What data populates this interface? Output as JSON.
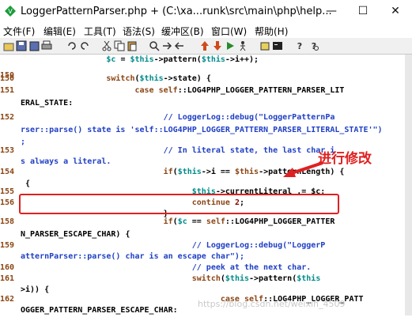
{
  "window": {
    "title": "LoggerPatternParser.php + (C:\\xa...runk\\src\\main\\php\\help..."
  },
  "menu": [
    "文件(F)",
    "编辑(E)",
    "工具(T)",
    "语法(S)",
    "缓冲区(B)",
    "窗口(W)",
    "帮助(H)"
  ],
  "editor": {
    "lines": [
      {
        "num": "",
        "tokens": [
          [
            "v",
            "                  $c"
          ],
          [
            "",
            " = "
          ],
          [
            "v",
            "$this"
          ],
          [
            "",
            "->pattern("
          ],
          [
            "v",
            "$this"
          ],
          [
            "",
            "->i++);"
          ]
        ]
      },
      {
        "num": "150",
        "tokens": []
      },
      {
        "num": "150",
        "tokens": [
          [
            "k",
            "                  switch"
          ],
          [
            "",
            "("
          ],
          [
            "v",
            "$this"
          ],
          [
            "",
            "->state) {"
          ]
        ]
      },
      {
        "num": "151",
        "tokens": [
          [
            "k",
            "                        case"
          ],
          [
            "",
            " "
          ],
          [
            "k",
            "self"
          ],
          [
            "",
            "::LOG4PHP_LOGGER_PATTERN_PARSER_LIT"
          ]
        ]
      },
      {
        "num": "",
        "tokens": [
          [
            "",
            "ERAL_STATE:"
          ]
        ]
      },
      {
        "num": "152",
        "tokens": [
          [
            "c",
            "                              // LoggerLog::debug(\"LoggerPatternPa"
          ]
        ]
      },
      {
        "num": "",
        "tokens": [
          [
            "c",
            "rser::parse() state is 'self::LOG4PHP_LOGGER_PATTERN_PARSER_LITERAL_STATE'\")"
          ]
        ]
      },
      {
        "num": "",
        "tokens": [
          [
            "c",
            ";"
          ]
        ]
      },
      {
        "num": "153",
        "tokens": [
          [
            "c",
            "                              // In literal state, the last char i"
          ]
        ]
      },
      {
        "num": "",
        "tokens": [
          [
            "c",
            "s always a literal."
          ]
        ]
      },
      {
        "num": "154",
        "tokens": [
          [
            "k",
            "                              if"
          ],
          [
            "",
            "("
          ],
          [
            "v",
            "$this"
          ],
          [
            "",
            "->i == "
          ],
          [
            "k",
            "$this"
          ],
          [
            "",
            "->patternLength) {"
          ]
        ]
      },
      {
        "num": "",
        "tokens": [
          [
            "",
            " {"
          ]
        ]
      },
      {
        "num": "155",
        "tokens": [
          [
            "v",
            "                                    $this"
          ],
          [
            "",
            "->currentLiteral .= $c;"
          ]
        ]
      },
      {
        "num": "156",
        "tokens": [
          [
            "k",
            "                                    continue"
          ],
          [
            "",
            " "
          ],
          [
            "s",
            "2"
          ],
          [
            "",
            ";"
          ]
        ]
      },
      {
        "num": "",
        "tokens": [
          [
            "",
            "                              }"
          ]
        ]
      },
      {
        "num": "158",
        "tokens": [
          [
            "k",
            "                              if"
          ],
          [
            "",
            "("
          ],
          [
            "v",
            "$c"
          ],
          [
            "",
            " == "
          ],
          [
            "k",
            "self"
          ],
          [
            "",
            "::LOG4PHP_LOGGER_PATTER"
          ]
        ]
      },
      {
        "num": "",
        "tokens": [
          [
            "",
            "N_PARSER_ESCAPE_CHAR) {"
          ]
        ]
      },
      {
        "num": "159",
        "tokens": [
          [
            "c",
            "                                    // LoggerLog::debug(\"LoggerP"
          ]
        ]
      },
      {
        "num": "",
        "tokens": [
          [
            "c",
            "atternParser::parse() char is an escape char\");"
          ]
        ]
      },
      {
        "num": "160",
        "tokens": [
          [
            "c",
            "                                    // peek at the next char."
          ]
        ]
      },
      {
        "num": "161",
        "tokens": [
          [
            "k",
            "                                    switch"
          ],
          [
            "",
            "("
          ],
          [
            "v",
            "$this"
          ],
          [
            "",
            "->pattern("
          ],
          [
            "v",
            "$this"
          ]
        ]
      },
      {
        "num": "",
        "tokens": [
          [
            "",
            ">i)) {"
          ]
        ]
      },
      {
        "num": "162",
        "tokens": [
          [
            "k",
            "                                          case"
          ],
          [
            "",
            " "
          ],
          [
            "k",
            "self"
          ],
          [
            "",
            "::LOG4PHP_LOGGER_PATT"
          ]
        ]
      },
      {
        "num": "",
        "tokens": [
          [
            "",
            "OGGER_PATTERN_PARSER_ESCAPE_CHAR:"
          ]
        ]
      }
    ]
  },
  "annotation": {
    "text": "进行修改"
  },
  "watermark": "https://blog.csdn.net/weixin_4509"
}
